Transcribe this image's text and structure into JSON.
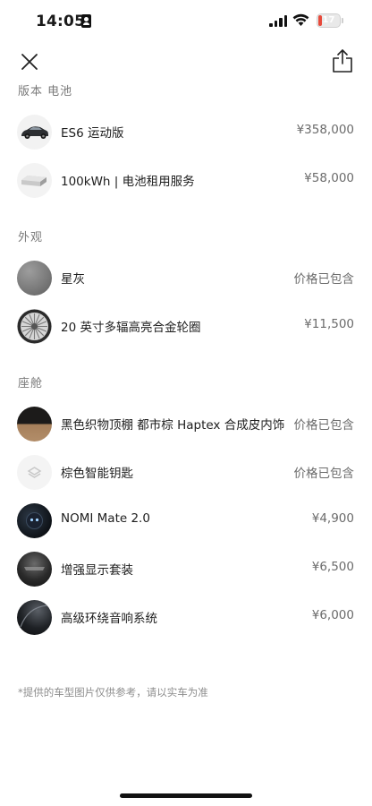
{
  "status_bar": {
    "time": "14:05",
    "battery": "17"
  },
  "sections": [
    {
      "title": "版本 电池",
      "items": [
        {
          "name": "ES6 运动版",
          "price": "¥358,000",
          "icon": "car-icon"
        },
        {
          "name": "100kWh | 电池租用服务",
          "price": "¥58,000",
          "icon": "battery-pack-icon"
        }
      ]
    },
    {
      "title": "外观",
      "items": [
        {
          "name": "星灰",
          "price": "价格已包含",
          "icon": "color-swatch-icon"
        },
        {
          "name": "20 英寸多辐高亮合金轮圈",
          "price": "¥11,500",
          "icon": "wheel-icon"
        }
      ]
    },
    {
      "title": "座舱",
      "items": [
        {
          "name": "黑色织物顶棚 都市棕 Haptex 合成皮内饰",
          "price": "价格已包含",
          "icon": "interior-swatch-icon"
        },
        {
          "name": "棕色智能钥匙",
          "price": "价格已包含",
          "icon": "key-icon"
        },
        {
          "name": "NOMI Mate 2.0",
          "price": "¥4,900",
          "icon": "nomi-icon"
        },
        {
          "name": "增强显示套装",
          "price": "¥6,500",
          "icon": "display-icon"
        },
        {
          "name": "高级环绕音响系统",
          "price": "¥6,000",
          "icon": "speaker-icon"
        }
      ]
    }
  ],
  "footnote": "*提供的车型图片仅供参考，请以实车为准",
  "colors": {
    "battery_low": "#e74a3b",
    "section_title": "#7a7a7a",
    "price": "#6b6b6b"
  }
}
